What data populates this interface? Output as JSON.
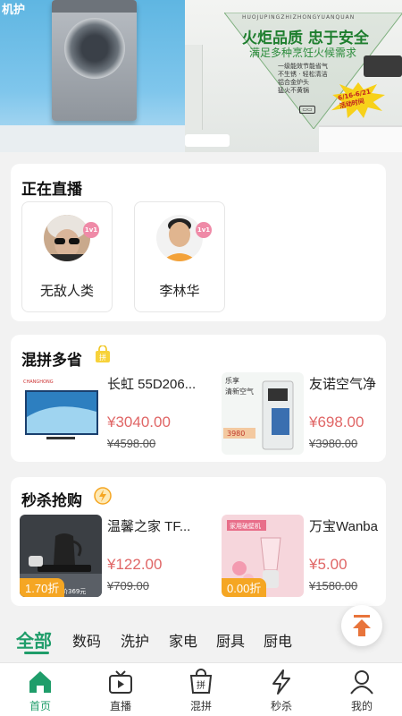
{
  "banner": {
    "left_text": "机护",
    "pinyin": "HUOJUPINGZHIZHONGYUANQUAN",
    "slogan": "火炬品质  忠于安全",
    "slogan_sub": "满足多种烹饪火候需求",
    "features": [
      "一级能效节能省气",
      "不生锈 · 轻松清洁",
      "铝合金炉头",
      "猛火不黄锅"
    ],
    "promo_date": "6/16-6/21",
    "promo_text": "活动时间"
  },
  "live": {
    "title": "正在直播",
    "anchors": [
      {
        "name": "无敌人类",
        "badge": "1v1"
      },
      {
        "name": "李林华",
        "badge": "1v1"
      }
    ]
  },
  "group_buy": {
    "title": "混拼多省",
    "products": [
      {
        "name": "长虹 55D206...",
        "price": "¥3040.00",
        "orig": "¥4598.00",
        "img_brand": "CHANGHONG"
      },
      {
        "name": "友诺空气净",
        "price": "¥698.00",
        "orig": "¥3980.00",
        "img_text_1": "乐享",
        "img_text_2": "清新空气",
        "img_price": "3980"
      }
    ]
  },
  "seckill": {
    "title": "秒杀抢购",
    "products": [
      {
        "name": "温馨之家 TF...",
        "price": "¥122.00",
        "orig": "¥709.00",
        "discount": "1.70折",
        "img_text": "一价369元"
      },
      {
        "name": "万宝Wanba",
        "price": "¥5.00",
        "orig": "¥1580.00",
        "discount": "0.00折",
        "img_text": "家用破壁机"
      }
    ]
  },
  "categories": [
    "全部",
    "数码",
    "洗护",
    "家电",
    "厨具",
    "厨电"
  ],
  "nav": [
    {
      "label": "首页",
      "icon": "home-icon"
    },
    {
      "label": "直播",
      "icon": "tv-icon"
    },
    {
      "label": "混拼",
      "icon": "bag-icon",
      "icon_text": "拼"
    },
    {
      "label": "秒杀",
      "icon": "lightning-icon"
    },
    {
      "label": "我的",
      "icon": "user-icon"
    }
  ],
  "colors": {
    "accent": "#1f9d6a",
    "price": "#e06666",
    "discount": "#f5a623",
    "badge": "#ef8aa7"
  }
}
